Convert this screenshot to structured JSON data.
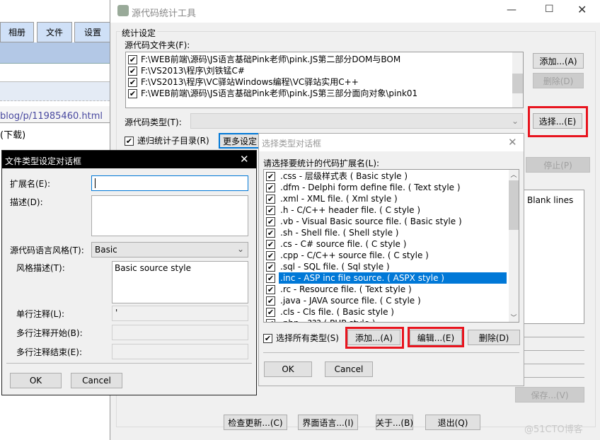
{
  "browser": {
    "tabs": [
      "相册",
      "文件",
      "设置"
    ],
    "url": "blog/p/11985460.html",
    "download": "(下载)"
  },
  "main": {
    "title": "源代码统计工具",
    "group": "统计设定",
    "folder_label": "源代码文件夹(F):",
    "folders": [
      "F:\\WEB前端\\源码\\JS语言基础Pink老师\\pink.JS第二部分DOM与BOM",
      "F:\\VS2013\\程序\\刘铁锰C#",
      "F:\\VS2013\\程序\\VC驿站Windows编程\\VC驿站实用C++",
      "F:\\WEB前端\\源码\\JS语言基础Pink老师\\pink.JS第三部分面向对象\\pink01"
    ],
    "add": "添加...(A)",
    "delete": "删除(D)",
    "type_label": "源代码类型(T):",
    "select": "选择...(E)",
    "recursive": "递归统计子目录(R)",
    "more": "更多设定",
    "stop": "停止(P)",
    "blank_lines": "Blank lines",
    "save": "保存...(V)",
    "bottom": [
      "检查更新...(C)",
      "界面语言...(I)",
      "关于...(B)",
      "退出(Q)"
    ],
    "watermark": "@51CTO博客"
  },
  "type_dialog": {
    "title": "选择类型对话框",
    "label": "请选择要统计的代码扩展名(L):",
    "items": [
      ".css - 层级样式表 ( Basic style )",
      ".dfm - Delphi form define file. ( Text style )",
      ".xml - XML file. ( Xml style )",
      ".h - C/C++ header file. ( C style )",
      ".vb - Visual Basic source file. ( Basic style )",
      ".sh - Shell file. ( Shell style )",
      ".cs - C# source file. ( C style )",
      ".cpp - C/C++ source file. ( C style )",
      ".sql - SQL file. ( Sql style )",
      ".inc - ASP inc file source. ( ASPX style )",
      ".rc - Resource file. ( Text style )",
      ".java - JAVA source file. ( C style )",
      ".cls - Cls file. ( Basic style )",
      ".php - ??? ( PHP style )"
    ],
    "selected_index": 9,
    "select_all": "选择所有类型(S)",
    "add": "添加...(A)",
    "edit": "编辑...(E)",
    "delete": "删除(D)",
    "ok": "OK",
    "cancel": "Cancel"
  },
  "file_dialog": {
    "title": "文件类型设定对话框",
    "ext_label": "扩展名(E):",
    "ext_value": "",
    "desc_label": "描述(D):",
    "style_label": "源代码语言风格(T):",
    "style_value": "Basic",
    "style_desc_label": "风格描述(T):",
    "style_desc_value": "Basic source style",
    "single_label": "单行注释(L):",
    "single_value": "'",
    "multi_start_label": "多行注释开始(B):",
    "multi_end_label": "多行注释结束(E):",
    "ok": "OK",
    "cancel": "Cancel"
  },
  "colors": {
    "highlight": "#0078d7",
    "callout": "#e8141e"
  }
}
